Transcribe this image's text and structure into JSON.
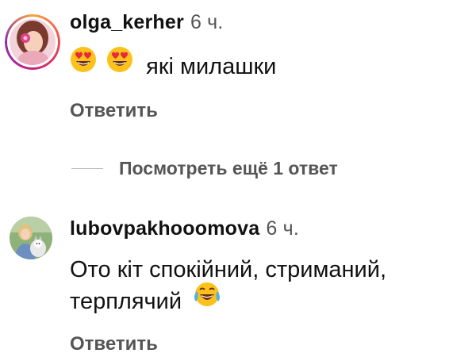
{
  "comments": [
    {
      "username": "olga_kerher",
      "time": "6 ч.",
      "emojis": [
        "heart-eyes-emoji",
        "heart-eyes-emoji"
      ],
      "text": "які милашки",
      "reply_label": "Ответить",
      "has_story_ring": true
    },
    {
      "username": "lubovpakhooomova",
      "time": "6 ч.",
      "text_line1": "Ото кіт спокійний, стриманий,",
      "text_line2": "терплячий",
      "emojis": [
        "tears-of-joy-emoji"
      ],
      "reply_label": "Ответить",
      "has_story_ring": false
    }
  ],
  "view_replies": {
    "label": "Посмотреть ещё 1 ответ"
  },
  "colors": {
    "text": "#111111",
    "muted": "#555555",
    "divider": "#bbbbbb",
    "story_ring": [
      "#f9a23b",
      "#f0474f",
      "#c9207a",
      "#8a2bb0"
    ]
  }
}
